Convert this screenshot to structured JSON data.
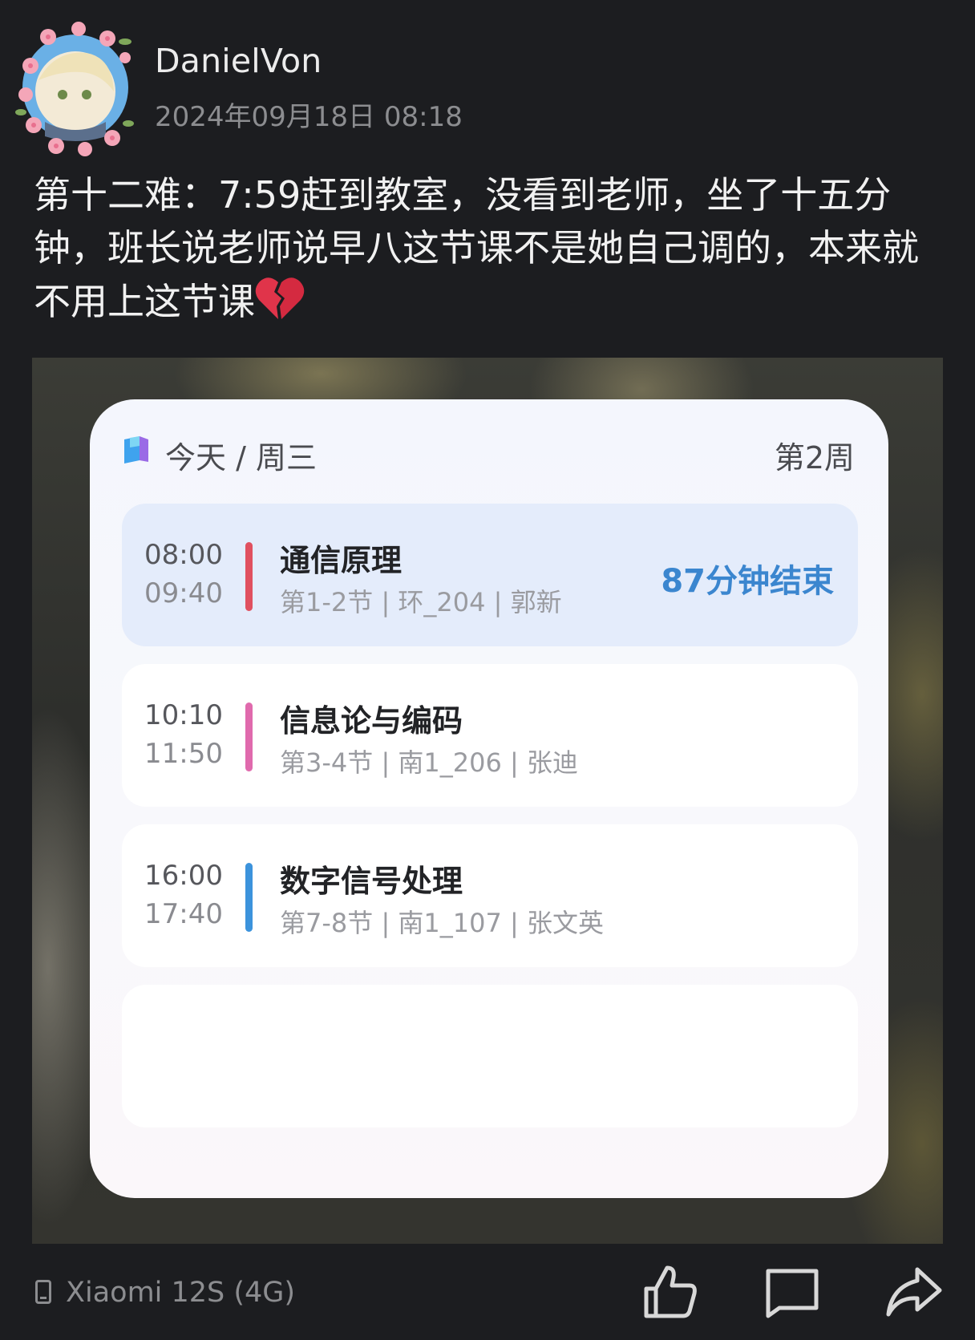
{
  "user": {
    "name": "DanielVon",
    "timestamp": "2024年09月18日 08:18"
  },
  "post": {
    "text": "第十二难：7:59赶到教室，没看到老师，坐了十五分钟，班长说老师说早八这节课不是她自己调的，本来就不用上这节课",
    "emoji": "broken-heart-icon"
  },
  "widget": {
    "title": "今天 / 周三",
    "week": "第2周",
    "courses": [
      {
        "start": "08:00",
        "end": "09:40",
        "name": "通信原理",
        "detail": "第1-2节 | 环_204 | 郭新",
        "status": "87分钟结束",
        "color": "#e0505f"
      },
      {
        "start": "10:10",
        "end": "11:50",
        "name": "信息论与编码",
        "detail": "第3-4节 | 南1_206 | 张迪",
        "color": "#e06aad"
      },
      {
        "start": "16:00",
        "end": "17:40",
        "name": "数字信号处理",
        "detail": "第7-8节 | 南1_107 | 张文英",
        "color": "#3c93dc"
      }
    ]
  },
  "footer": {
    "device": "Xiaomi 12S (4G)",
    "actions": [
      "like-icon",
      "comment-icon",
      "share-icon"
    ]
  }
}
